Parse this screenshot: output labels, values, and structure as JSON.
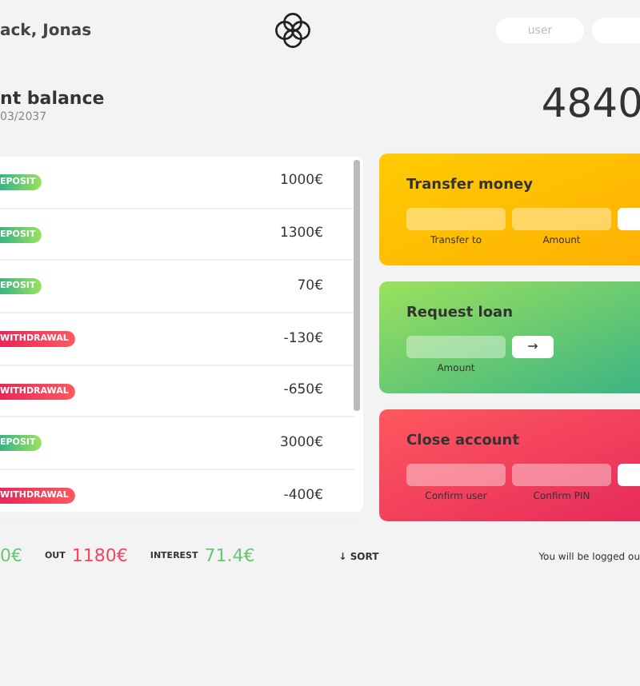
{
  "header": {
    "greeting": "ack, Jonas",
    "login_placeholder": "user"
  },
  "balance": {
    "label": "nt balance",
    "date": "03/2037",
    "value": "4840"
  },
  "movements": [
    {
      "kind": "deposit",
      "label": "EPOSIT",
      "value": "1000€"
    },
    {
      "kind": "deposit",
      "label": "EPOSIT",
      "value": "1300€"
    },
    {
      "kind": "deposit",
      "label": "EPOSIT",
      "value": "70€"
    },
    {
      "kind": "withdrawal",
      "label": "WITHDRAWAL",
      "value": "-130€"
    },
    {
      "kind": "withdrawal",
      "label": "WITHDRAWAL",
      "value": "-650€"
    },
    {
      "kind": "deposit",
      "label": "EPOSIT",
      "value": "3000€"
    },
    {
      "kind": "withdrawal",
      "label": "WITHDRAWAL",
      "value": "-400€"
    }
  ],
  "operations": [
    {
      "kind": "transfer",
      "title": "Transfer money",
      "fields": [
        "Transfer to",
        "Amount"
      ]
    },
    {
      "kind": "loan",
      "title": "Request loan",
      "fields": [
        "Amount"
      ],
      "button": "→"
    },
    {
      "kind": "close",
      "title": "Close account",
      "fields": [
        "Confirm user",
        "Confirm PIN"
      ]
    }
  ],
  "summary": [
    {
      "kind": "in",
      "value": "0€"
    },
    {
      "kind": "out",
      "label": "OUT",
      "value": "1180€"
    },
    {
      "kind": "interest",
      "label": "INTEREST",
      "value": "71.4€"
    }
  ],
  "sort": "↓ SORT",
  "logout_timer": "You will be logged ou"
}
